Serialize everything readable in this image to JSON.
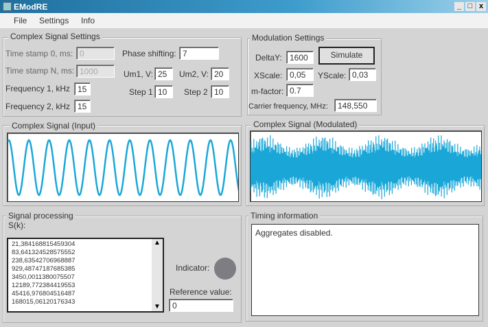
{
  "window": {
    "title": "EModRE",
    "minimize": "_",
    "maximize": "□",
    "close": "x"
  },
  "menu": [
    "File",
    "Settings",
    "Info"
  ],
  "complex": {
    "title": "Complex Signal Settings",
    "ts0_label": "Time stamp 0, ms:",
    "ts0": "0",
    "tsn_label": "Time stamp N, ms:",
    "tsn": "1000",
    "f1_label": "Frequency 1, kHz",
    "f1": "15",
    "f2_label": "Frequency 2, kHz",
    "f2": "15",
    "phase_label": "Phase shifting:",
    "phase": "7",
    "um1_label": "Um1, V:",
    "um1": "25",
    "um2_label": "Um2, V:",
    "um2": "20",
    "step1_label": "Step 1",
    "step1": "10",
    "step2_label": "Step 2",
    "step2": "10"
  },
  "modulation": {
    "title": "Modulation Settings",
    "deltay_label": "DeltaY:",
    "deltay": "1600",
    "simulate": "Simulate",
    "xscale_label": "XScale:",
    "xscale": "0,05",
    "yscale_label": "YScale:",
    "yscale": "0,03",
    "m_label": "m-factor:",
    "m": "0.7",
    "carrier_label": "Carrier frequency, MHz:",
    "carrier": "148,550"
  },
  "input_chart": {
    "title": "Complex Signal (Input)",
    "color": "#1aa7d8",
    "periods": 11.5
  },
  "mod_chart": {
    "title": "Complex Signal (Modulated)",
    "color": "#1aa7d8"
  },
  "processing": {
    "title": "Signal processing",
    "sk_label": "S(k):",
    "values": [
      "21,384168815459304",
      "83,641324528575552",
      "238,63542706968887",
      "929,48747187685385",
      "3450,0011380075507",
      "12189,772384419553",
      "45416,976804516487",
      "168015,06120176343"
    ],
    "indicator_label": "Indicator:",
    "ref_label": "Reference value:",
    "ref": "0",
    "scroll_up": "▲",
    "scroll_down": "▼"
  },
  "timing": {
    "title": "Timing information",
    "text": "Aggregates disabled."
  }
}
